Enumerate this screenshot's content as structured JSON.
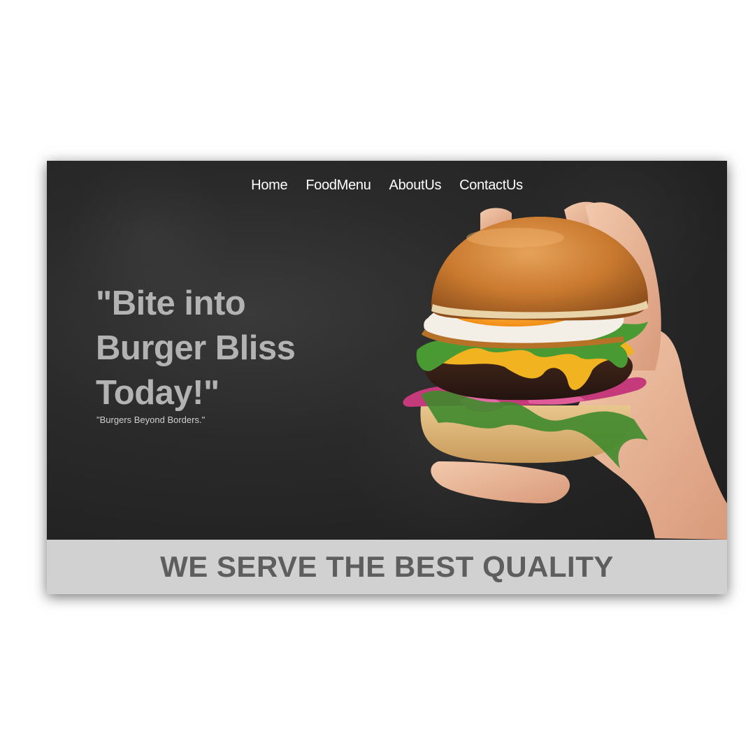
{
  "nav": {
    "items": [
      {
        "label": "Home"
      },
      {
        "label": "FoodMenu"
      },
      {
        "label": "AboutUs"
      },
      {
        "label": "ContactUs"
      }
    ]
  },
  "hero": {
    "headline_line1": "\"Bite into",
    "headline_line2": "Burger Bliss",
    "headline_line3": "Today!\"",
    "tagline": "\"Burgers Beyond Borders.\""
  },
  "banner": {
    "text": "WE SERVE THE BEST QUALITY"
  },
  "colors": {
    "hero_background": "#2a2a2a",
    "headline": "#b3b3b3",
    "banner_background": "#d1d1d1",
    "banner_text": "#5e5e5e"
  }
}
